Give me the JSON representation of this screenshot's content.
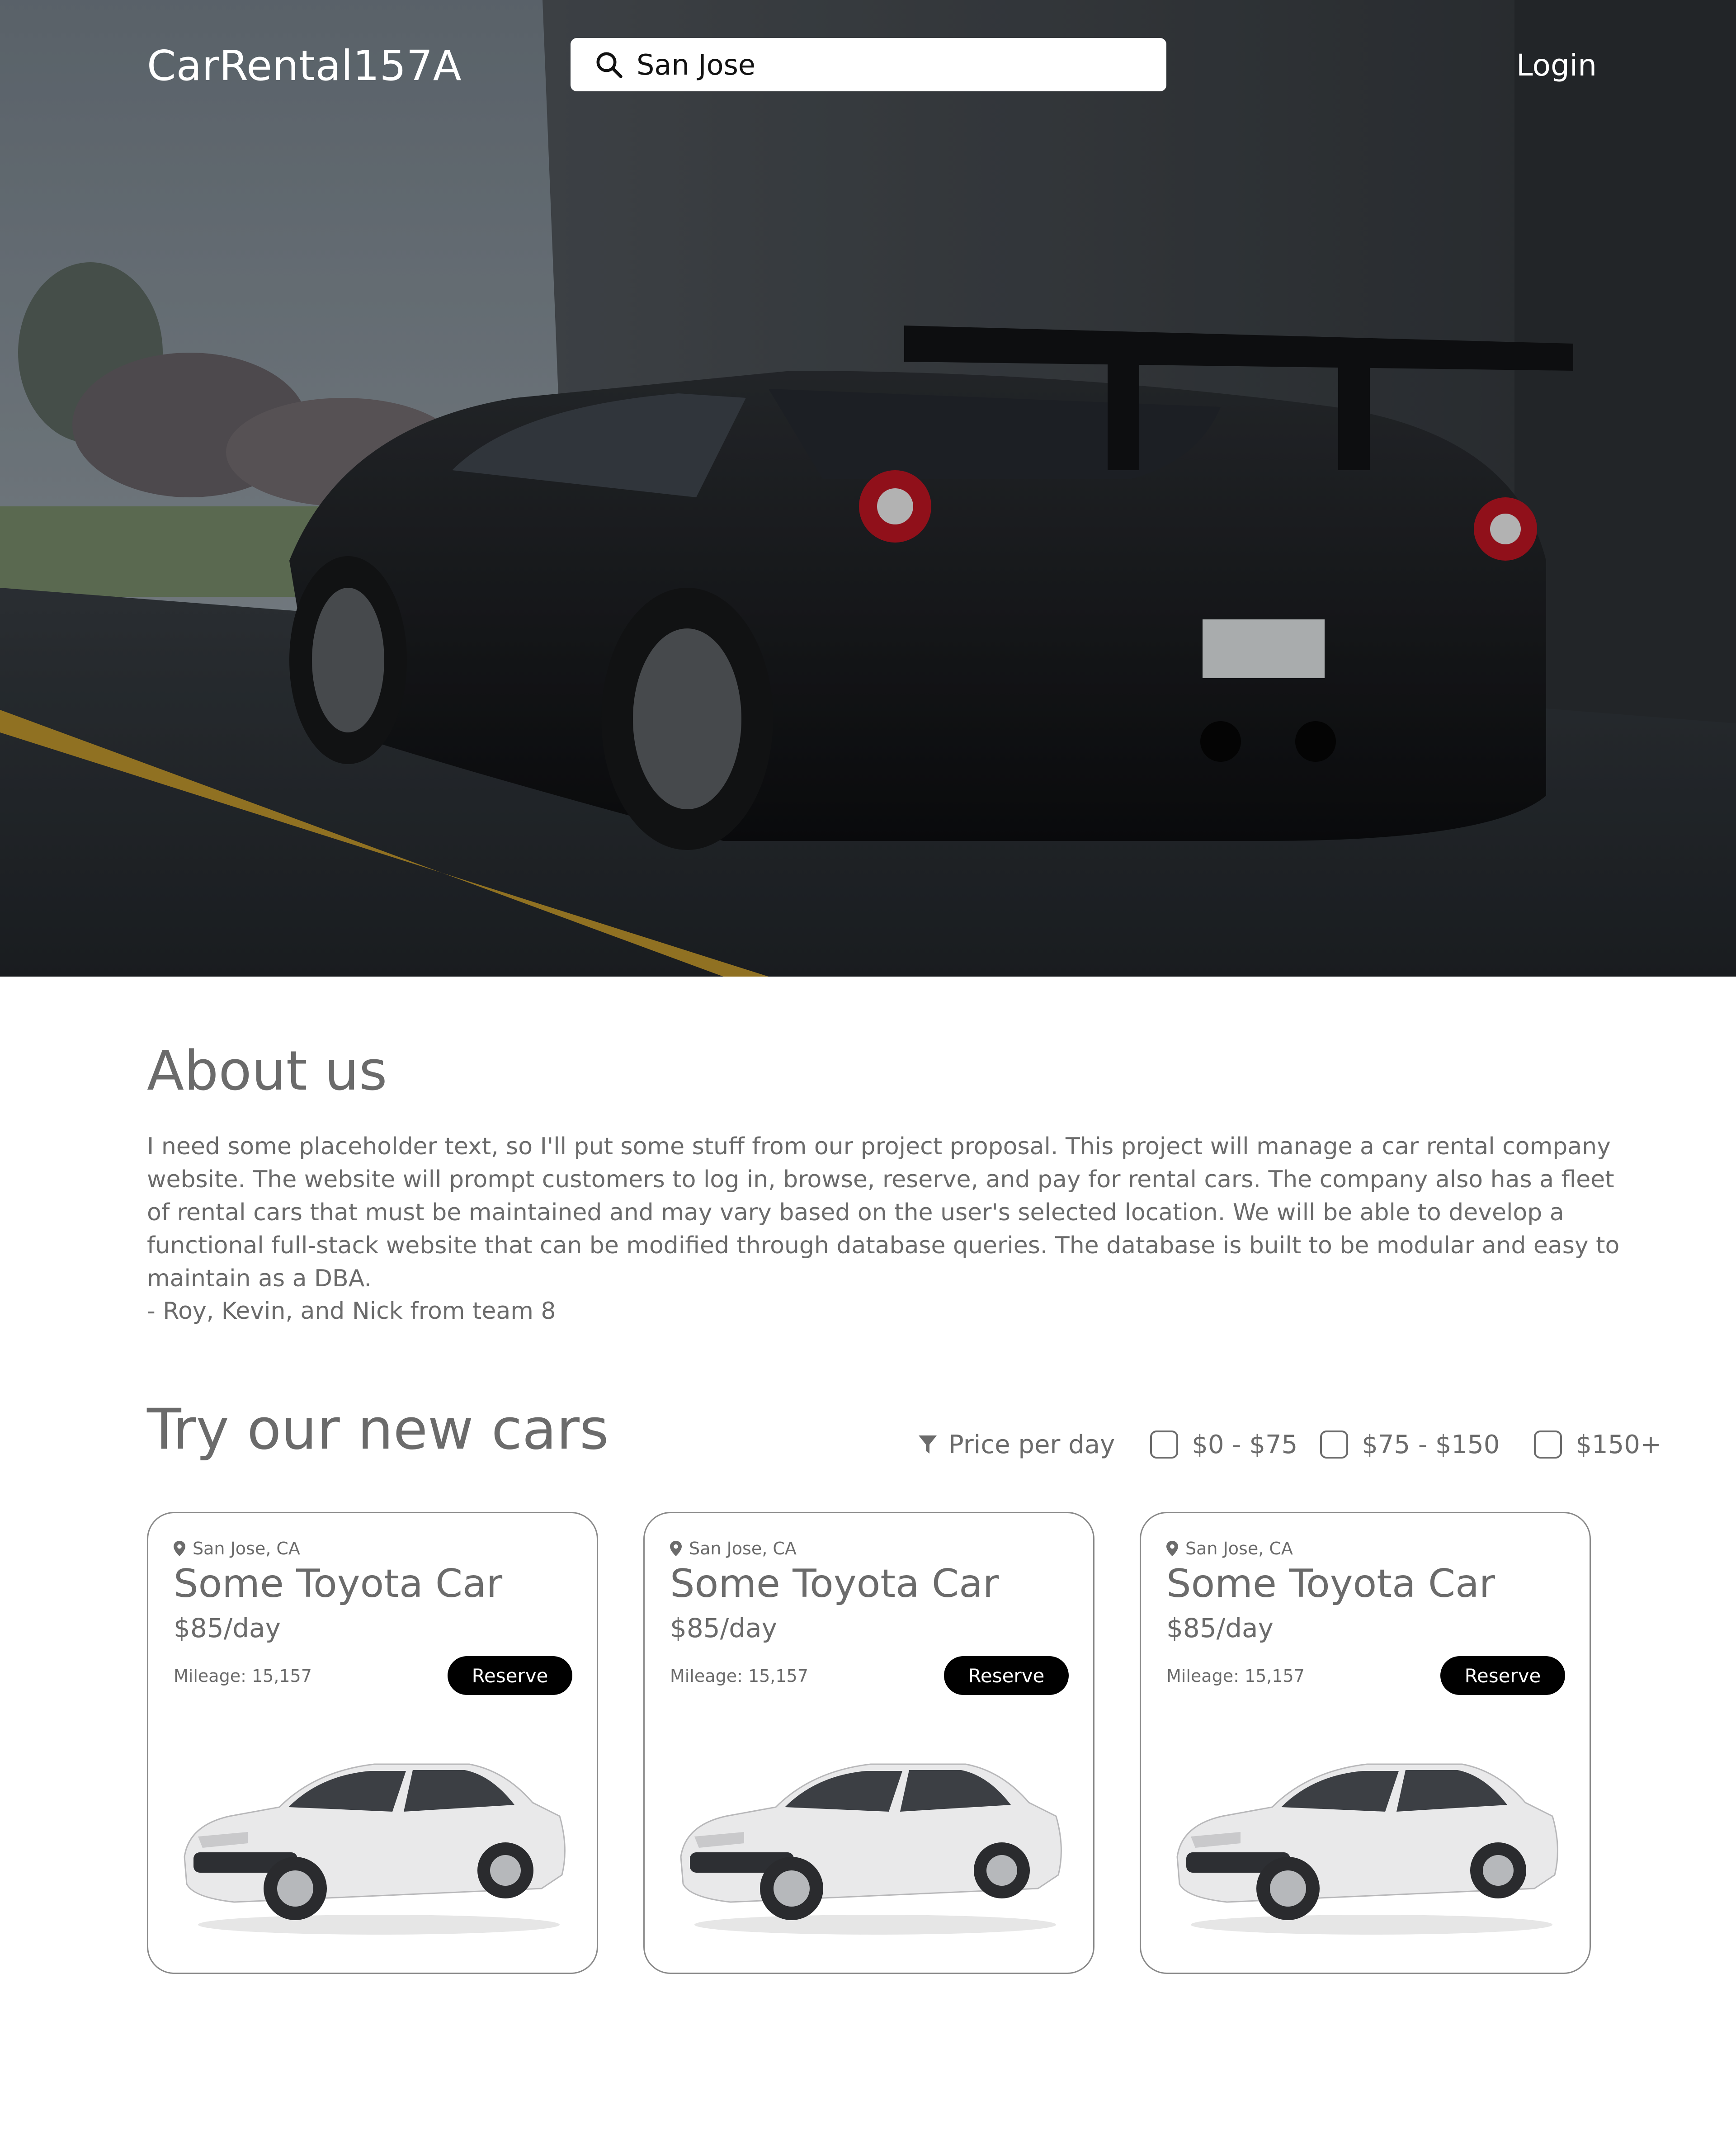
{
  "header": {
    "brand": "CarRental157A",
    "search": {
      "value": "San Jose",
      "icon": "search-icon"
    },
    "login_label": "Login"
  },
  "hero": {
    "image": "black-sports-car-photo"
  },
  "about": {
    "title": "About us",
    "body": "I need some placeholder text, so I'll put some stuff from our project proposal. This project will manage a car rental company website. The website will prompt customers to log in, browse,  reserve, and pay for rental cars. The company also has a fleet of rental cars that must be maintained and may vary based on the user's selected location. We will be able to develop a functional full-stack website that can be modified through database queries. The database is built to be modular and easy to maintain as a DBA.",
    "signature": "- Roy, Kevin, and Nick from team 8"
  },
  "cars_section": {
    "title": "Try our new cars",
    "filter": {
      "label": "Price per day",
      "icon": "filter-icon",
      "options": [
        {
          "label": "$0 - $75",
          "checked": false
        },
        {
          "label": "$75 - $150",
          "checked": false
        },
        {
          "label": "$150+",
          "checked": false
        }
      ]
    },
    "cars": [
      {
        "location": "San Jose, CA",
        "name": "Some Toyota Car",
        "price": "$85/day",
        "mileage": "Mileage: 15,157",
        "button": "Reserve",
        "image": "white-toyota-sedan"
      },
      {
        "location": "San Jose, CA",
        "name": "Some Toyota Car",
        "price": "$85/day",
        "mileage": "Mileage: 15,157",
        "button": "Reserve",
        "image": "white-toyota-sedan"
      },
      {
        "location": "San Jose, CA",
        "name": "Some Toyota Car",
        "price": "$85/day",
        "mileage": "Mileage: 15,157",
        "button": "Reserve",
        "image": "white-toyota-sedan"
      }
    ]
  }
}
